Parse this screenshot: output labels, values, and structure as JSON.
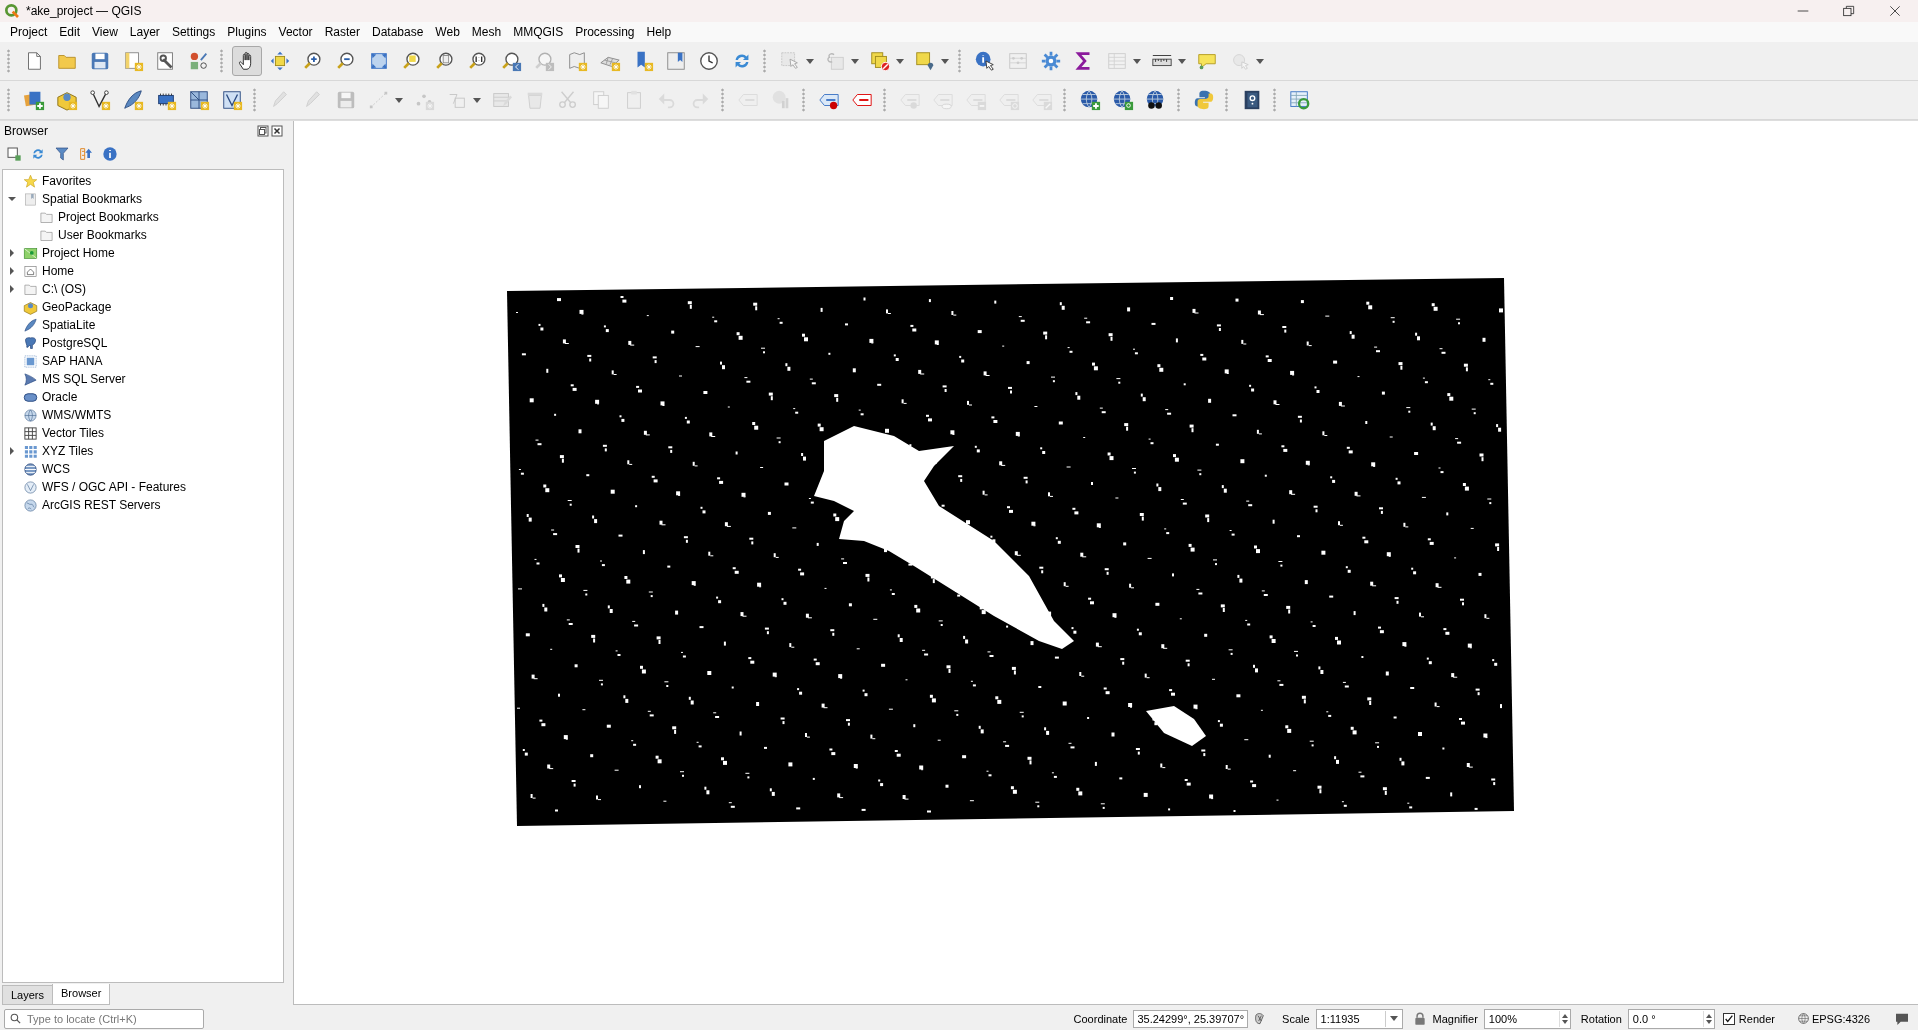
{
  "window": {
    "title": "*ake_project — QGIS"
  },
  "menu": [
    "Project",
    "Edit",
    "View",
    "Layer",
    "Settings",
    "Plugins",
    "Vector",
    "Raster",
    "Database",
    "Web",
    "Mesh",
    "MMQGIS",
    "Processing",
    "Help"
  ],
  "toolbars": [
    {
      "groups": [
        {
          "tools": [
            {
              "kind": "newfile",
              "disabled": false,
              "selected": false,
              "dropdown": false
            },
            {
              "kind": "open",
              "disabled": false,
              "selected": false,
              "dropdown": false
            },
            {
              "kind": "save",
              "disabled": false,
              "selected": false,
              "dropdown": false
            },
            {
              "kind": "newlayout",
              "disabled": false,
              "selected": false,
              "dropdown": false
            },
            {
              "kind": "layoutmgr",
              "disabled": false,
              "selected": false,
              "dropdown": false
            },
            {
              "kind": "stylemgr",
              "disabled": false,
              "selected": false,
              "dropdown": false
            }
          ]
        },
        {
          "tools": [
            {
              "kind": "pan",
              "disabled": false,
              "selected": true,
              "dropdown": false
            },
            {
              "kind": "panselect",
              "disabled": false,
              "selected": false,
              "dropdown": false
            },
            {
              "kind": "zoomin",
              "disabled": false,
              "selected": false,
              "dropdown": false
            },
            {
              "kind": "zoomout",
              "disabled": false,
              "selected": false,
              "dropdown": false
            },
            {
              "kind": "zoomfull",
              "disabled": false,
              "selected": false,
              "dropdown": false
            },
            {
              "kind": "zoomsel",
              "disabled": false,
              "selected": false,
              "dropdown": false
            },
            {
              "kind": "zoomlayer",
              "disabled": false,
              "selected": false,
              "dropdown": false
            },
            {
              "kind": "zoomnative",
              "disabled": false,
              "selected": false,
              "dropdown": false
            },
            {
              "kind": "zoomlast",
              "disabled": false,
              "selected": false,
              "dropdown": false
            },
            {
              "kind": "zoomnext",
              "disabled": true,
              "selected": false,
              "dropdown": false
            },
            {
              "kind": "mapview",
              "disabled": false,
              "selected": false,
              "dropdown": false
            },
            {
              "kind": "view3d",
              "disabled": false,
              "selected": false,
              "dropdown": false
            },
            {
              "kind": "newbookmark",
              "disabled": false,
              "selected": false,
              "dropdown": false
            },
            {
              "kind": "bookmarks",
              "disabled": false,
              "selected": false,
              "dropdown": false
            },
            {
              "kind": "clock",
              "disabled": false,
              "selected": false,
              "dropdown": false
            },
            {
              "kind": "refresh",
              "disabled": false,
              "selected": false,
              "dropdown": false
            }
          ]
        },
        {
          "tools": [
            {
              "kind": "select",
              "disabled": true,
              "selected": false,
              "dropdown": true
            },
            {
              "kind": "expression",
              "disabled": true,
              "selected": false,
              "dropdown": true
            },
            {
              "kind": "deselect",
              "disabled": false,
              "selected": false,
              "dropdown": true
            },
            {
              "kind": "selectloc",
              "disabled": false,
              "selected": false,
              "dropdown": true
            }
          ]
        },
        {
          "tools": [
            {
              "kind": "identify",
              "disabled": false,
              "selected": false,
              "dropdown": false
            },
            {
              "kind": "abacus",
              "disabled": true,
              "selected": false,
              "dropdown": false
            },
            {
              "kind": "gear",
              "disabled": false,
              "selected": false,
              "dropdown": false
            },
            {
              "kind": "sigma",
              "disabled": false,
              "selected": false,
              "dropdown": false
            },
            {
              "kind": "table",
              "disabled": true,
              "selected": false,
              "dropdown": true
            },
            {
              "kind": "ruler",
              "disabled": false,
              "selected": false,
              "dropdown": true
            },
            {
              "kind": "tip",
              "disabled": false,
              "selected": false,
              "dropdown": false
            },
            {
              "kind": "action",
              "disabled": true,
              "selected": false,
              "dropdown": true
            }
          ]
        }
      ]
    },
    {
      "groups": [
        {
          "tools": [
            {
              "kind": "dsm",
              "disabled": false,
              "selected": false,
              "dropdown": false
            },
            {
              "kind": "newgpkg",
              "disabled": false,
              "selected": false,
              "dropdown": false
            },
            {
              "kind": "newshp",
              "disabled": false,
              "selected": false,
              "dropdown": false
            },
            {
              "kind": "newspatialite",
              "disabled": false,
              "selected": false,
              "dropdown": false
            },
            {
              "kind": "newvirtual",
              "disabled": false,
              "selected": false,
              "dropdown": false
            },
            {
              "kind": "newtemp",
              "disabled": false,
              "selected": false,
              "dropdown": false
            },
            {
              "kind": "newvlayer",
              "disabled": false,
              "selected": false,
              "dropdown": false
            }
          ]
        },
        {
          "tools": [
            {
              "kind": "pencil",
              "disabled": true,
              "selected": false,
              "dropdown": false
            },
            {
              "kind": "pencil",
              "disabled": true,
              "selected": false,
              "dropdown": false
            },
            {
              "kind": "save",
              "disabled": true,
              "selected": false,
              "dropdown": false
            },
            {
              "kind": "line",
              "disabled": true,
              "selected": false,
              "dropdown": true
            },
            {
              "kind": "points",
              "disabled": true,
              "selected": false,
              "dropdown": false
            },
            {
              "kind": "vertex",
              "disabled": true,
              "selected": false,
              "dropdown": true
            },
            {
              "kind": "attrs",
              "disabled": true,
              "selected": false,
              "dropdown": false
            },
            {
              "kind": "delete",
              "disabled": true,
              "selected": false,
              "dropdown": false
            },
            {
              "kind": "cut",
              "disabled": true,
              "selected": false,
              "dropdown": false
            },
            {
              "kind": "copy",
              "disabled": true,
              "selected": false,
              "dropdown": false
            },
            {
              "kind": "paste",
              "disabled": true,
              "selected": false,
              "dropdown": false
            },
            {
              "kind": "undo",
              "disabled": true,
              "selected": false,
              "dropdown": false
            },
            {
              "kind": "redo",
              "disabled": true,
              "selected": false,
              "dropdown": false
            }
          ]
        },
        {
          "tools": [
            {
              "kind": "label",
              "disabled": true,
              "selected": false,
              "dropdown": false
            },
            {
              "kind": "diagram",
              "disabled": true,
              "selected": false,
              "dropdown": false
            }
          ]
        },
        {
          "tools": [
            {
              "kind": "labeltool",
              "disabled": false,
              "selected": false,
              "dropdown": false
            },
            {
              "kind": "labelred",
              "disabled": false,
              "selected": false,
              "dropdown": false
            }
          ]
        },
        {
          "tools": [
            {
              "kind": "pinlabel",
              "disabled": true,
              "selected": false,
              "dropdown": false
            },
            {
              "kind": "showlabel",
              "disabled": true,
              "selected": false,
              "dropdown": false
            },
            {
              "kind": "movelabel",
              "disabled": true,
              "selected": false,
              "dropdown": false
            },
            {
              "kind": "rotatelabel",
              "disabled": true,
              "selected": false,
              "dropdown": false
            },
            {
              "kind": "changelabel",
              "disabled": true,
              "selected": false,
              "dropdown": false
            }
          ]
        },
        {
          "tools": [
            {
              "kind": "globeplus",
              "disabled": false,
              "selected": false,
              "dropdown": false
            },
            {
              "kind": "globesearch",
              "disabled": false,
              "selected": false,
              "dropdown": false
            },
            {
              "kind": "globebinoc",
              "disabled": false,
              "selected": false,
              "dropdown": false
            }
          ]
        },
        {
          "tools": [
            {
              "kind": "python",
              "disabled": false,
              "selected": false,
              "dropdown": false
            }
          ]
        },
        {
          "tools": [
            {
              "kind": "help",
              "disabled": false,
              "selected": false,
              "dropdown": false
            }
          ]
        },
        {
          "tools": [
            {
              "kind": "tablerefresh",
              "disabled": false,
              "selected": false,
              "dropdown": false
            }
          ]
        }
      ]
    }
  ],
  "browser_panel": {
    "title": "Browser",
    "tree": [
      {
        "label": "Favorites",
        "kind": "star"
      },
      {
        "label": "Spatial Bookmarks",
        "kind": "bookmark",
        "expanded": true,
        "children": [
          {
            "label": "Project Bookmarks",
            "kind": "folder"
          },
          {
            "label": "User Bookmarks",
            "kind": "folder"
          }
        ]
      },
      {
        "label": "Project Home",
        "kind": "projecthome",
        "expanded": false
      },
      {
        "label": "Home",
        "kind": "home",
        "expanded": false
      },
      {
        "label": "C:\\ (OS)",
        "kind": "folder",
        "expanded": false
      },
      {
        "label": "GeoPackage",
        "kind": "geopackage"
      },
      {
        "label": "SpatiaLite",
        "kind": "spatialite"
      },
      {
        "label": "PostgreSQL",
        "kind": "postgres"
      },
      {
        "label": "SAP HANA",
        "kind": "hana"
      },
      {
        "label": "MS SQL Server",
        "kind": "mssql"
      },
      {
        "label": "Oracle",
        "kind": "oracle"
      },
      {
        "label": "WMS/WMTS",
        "kind": "wms"
      },
      {
        "label": "Vector Tiles",
        "kind": "vectortiles"
      },
      {
        "label": "XYZ Tiles",
        "kind": "xyz",
        "expanded": false
      },
      {
        "label": "WCS",
        "kind": "wcs"
      },
      {
        "label": "WFS / OGC API - Features",
        "kind": "wfs"
      },
      {
        "label": "ArcGIS REST Servers",
        "kind": "arcgis"
      }
    ]
  },
  "dock_tabs": [
    {
      "label": "Layers",
      "selected": false
    },
    {
      "label": "Browser",
      "selected": true
    }
  ],
  "status_bar": {
    "locator": {
      "placeholder": "Type to locate (Ctrl+K)"
    },
    "coordinate": {
      "label": "Coordinate",
      "value": "35.24299°, 25.39707°"
    },
    "scale": {
      "label": "Scale",
      "value": "1:11935"
    },
    "magnifier": {
      "label": "Magnifier",
      "value": "100%"
    },
    "rotation": {
      "label": "Rotation",
      "value": "0.0 °"
    },
    "render": {
      "label": "Render",
      "checked": true
    },
    "crs": "EPSG:4326"
  }
}
